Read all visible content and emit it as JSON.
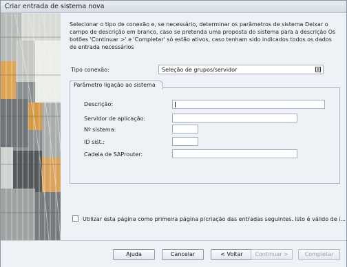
{
  "window": {
    "title": "Criar entrada de sistema nova"
  },
  "intro_text": "Selecionar o tipo de conexão e, se necessário, determinar os parâmetros de sistema Deixar o campo de descrição em branco, caso se pretenda uma proposta do sistema para a descrição Os botões 'Continuar >' e 'Completar' só estão ativos, caso tenham sido indicados todos os dados de entrada necessários",
  "connection_type": {
    "label": "Tipo conexão:",
    "value": "Seleção de grupos/servidor",
    "button_icon": "value-help-icon"
  },
  "params_group": {
    "title": "Parâmetro ligação ao sistema",
    "fields": [
      {
        "label": "Descrição:",
        "value": ""
      },
      {
        "label": "Servidor de aplicação:",
        "value": ""
      },
      {
        "label": "Nº sistema:",
        "value": ""
      },
      {
        "label": "ID sist.:",
        "value": ""
      },
      {
        "label": "Cadeia de SAProuter:",
        "value": ""
      }
    ]
  },
  "first_page_checkbox": {
    "label": "Utilizar esta página como primeira página p/criação das entradas seguintes. Isto é válido de i...",
    "checked": false
  },
  "buttons": {
    "help": "Ajuda",
    "cancel": "Cancelar",
    "back": "< Voltar",
    "continue": "Continuar >",
    "complete": "Completar"
  },
  "colors": {
    "panel_background": "#eef1f6",
    "disabled_text": "#9aa2ad"
  }
}
